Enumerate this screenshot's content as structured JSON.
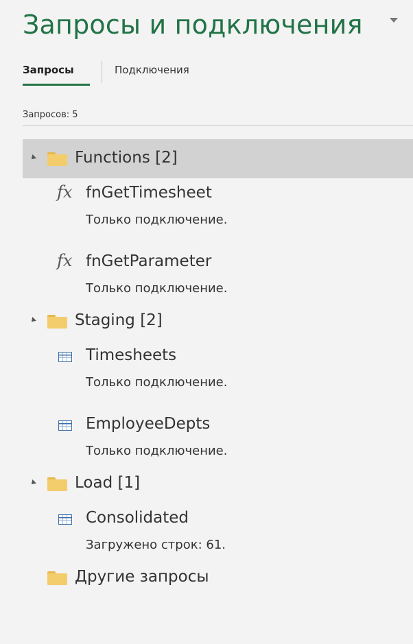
{
  "pane": {
    "title": "Запросы и подключения",
    "menu_icon": "chevron-down-icon"
  },
  "tabs": [
    {
      "label": "Запросы",
      "active": true
    },
    {
      "label": "Подключения",
      "active": false
    }
  ],
  "query_count": "Запросов: 5",
  "groups": [
    {
      "label": "Functions [2]",
      "selected": true,
      "items": [
        {
          "icon": "function-icon",
          "name": "fnGetTimesheet",
          "status": "Только подключение."
        },
        {
          "icon": "function-icon",
          "name": "fnGetParameter",
          "status": "Только подключение."
        }
      ]
    },
    {
      "label": "Staging [2]",
      "selected": false,
      "items": [
        {
          "icon": "table-icon",
          "name": "Timesheets",
          "status": "Только подключение."
        },
        {
          "icon": "table-icon",
          "name": "EmployeeDepts",
          "status": "Только подключение."
        }
      ]
    },
    {
      "label": "Load [1]",
      "selected": false,
      "items": [
        {
          "icon": "table-icon",
          "name": "Consolidated",
          "status": "Загружено строк: 61."
        }
      ]
    }
  ],
  "other_group": {
    "label": "Другие запросы"
  },
  "colors": {
    "accent": "#217346",
    "selected_bg": "#d2d2d2",
    "folder": "#f3cd6b",
    "table_icon": "#3a6ea8"
  }
}
